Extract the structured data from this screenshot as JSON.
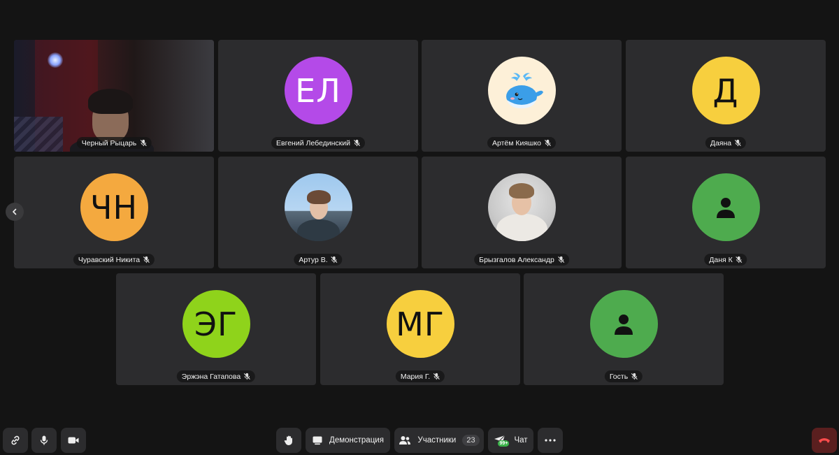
{
  "tiles": [
    {
      "name": "Черный Рыцарь",
      "type": "video"
    },
    {
      "name": "Евгений Лебединский",
      "initials": "ЕЛ",
      "color": "#b44ae8"
    },
    {
      "name": "Артём Кияшко",
      "type": "whale",
      "color": "#fdf0d8"
    },
    {
      "name": "Даяна",
      "initials": "Д",
      "color": "#f7cf3e"
    },
    {
      "name": "Чуравский Никита",
      "initials": "ЧН",
      "color": "#f4a93f"
    },
    {
      "name": "Артур В.",
      "type": "photo"
    },
    {
      "name": "Брызгалов Александр",
      "type": "photo"
    },
    {
      "name": "Даня К",
      "type": "generic",
      "color": "#4eab4e"
    },
    {
      "name": "Эржэна Гатапова",
      "initials": "ЭГ",
      "color": "#8fd31b"
    },
    {
      "name": "Мария Г.",
      "initials": "МГ",
      "color": "#f7cf3e"
    },
    {
      "name": "Гость",
      "type": "generic",
      "color": "#4eab4e"
    }
  ],
  "toolbar": {
    "link_icon": "link-icon",
    "mic_icon": "microphone-icon",
    "camera_icon": "camera-icon",
    "hand_icon": "raise-hand-icon",
    "screen_share_label": "Демонстрация",
    "participants_label": "Участники",
    "participants_count": "23",
    "chat_label": "Чат",
    "chat_badge": "99+",
    "more_icon": "more-icon",
    "hangup_icon": "hang-up-icon"
  },
  "colors": {
    "background": "#141414",
    "tile": "#2c2c2e",
    "button": "#2c2c2e",
    "hangup": "#5a1f1f",
    "hangup_icon": "#ff4c4c"
  }
}
